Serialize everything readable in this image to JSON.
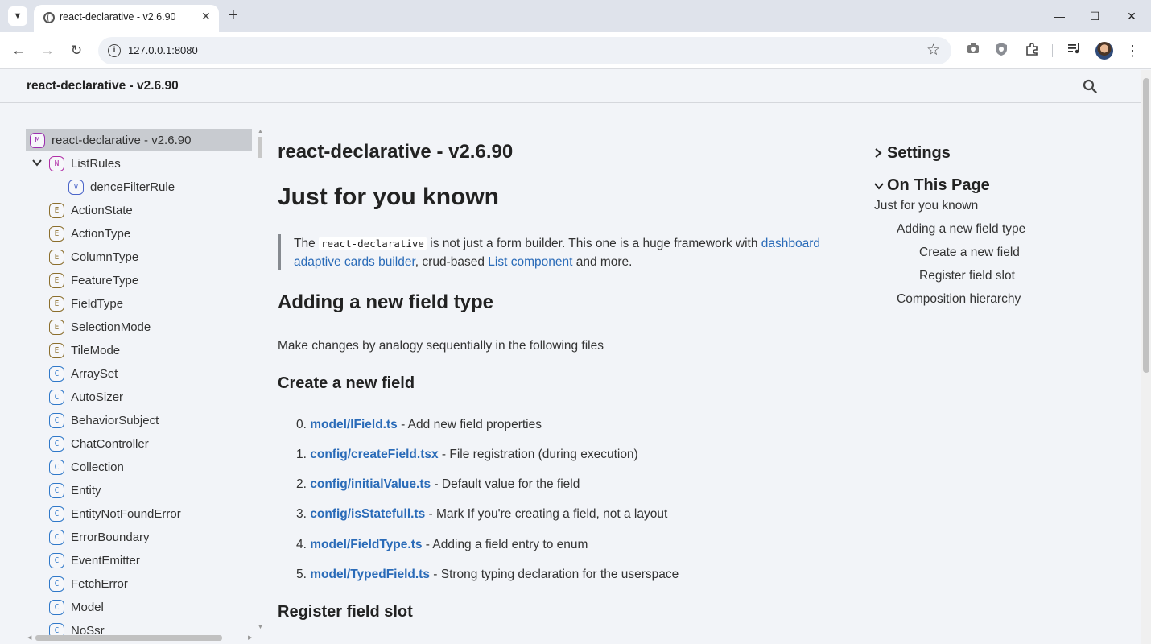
{
  "browser": {
    "tab_title": "react-declarative - v2.6.90",
    "url": "127.0.0.1:8080"
  },
  "header": {
    "site_title": "react-declarative - v2.6.90"
  },
  "sidebar": {
    "root": {
      "kind": "M",
      "label": "react-declarative - v2.6.90"
    },
    "group": {
      "kind": "N",
      "label": "ListRules"
    },
    "child": {
      "kind": "V",
      "label": "denceFilterRule"
    },
    "items": [
      {
        "kind": "E",
        "label": "ActionState"
      },
      {
        "kind": "E",
        "label": "ActionType"
      },
      {
        "kind": "E",
        "label": "ColumnType"
      },
      {
        "kind": "E",
        "label": "FeatureType"
      },
      {
        "kind": "E",
        "label": "FieldType"
      },
      {
        "kind": "E",
        "label": "SelectionMode"
      },
      {
        "kind": "E",
        "label": "TileMode"
      },
      {
        "kind": "C",
        "label": "ArraySet"
      },
      {
        "kind": "C",
        "label": "AutoSizer"
      },
      {
        "kind": "C",
        "label": "BehaviorSubject"
      },
      {
        "kind": "C",
        "label": "ChatController"
      },
      {
        "kind": "C",
        "label": "Collection"
      },
      {
        "kind": "C",
        "label": "Entity"
      },
      {
        "kind": "C",
        "label": "EntityNotFoundError"
      },
      {
        "kind": "C",
        "label": "ErrorBoundary"
      },
      {
        "kind": "C",
        "label": "EventEmitter"
      },
      {
        "kind": "C",
        "label": "FetchError"
      },
      {
        "kind": "C",
        "label": "Model"
      },
      {
        "kind": "C",
        "label": "NoSsr"
      }
    ]
  },
  "main": {
    "title": "react-declarative - v2.6.90",
    "h1": "Just for you known",
    "quote": {
      "t1": "The ",
      "code": "react-declarative",
      "t2": " is not just a form builder. This one is a huge framework with ",
      "link1": "dashboard adaptive cards builder",
      "t3": ", crud-based ",
      "link2": "List component",
      "t4": " and more."
    },
    "h2": "Adding a new field type",
    "para": "Make changes by analogy sequentially in the following files",
    "h3_create": "Create a new field",
    "steps": [
      {
        "num": "0.",
        "file": "model/IField.ts",
        "desc": " - Add new field properties"
      },
      {
        "num": "1.",
        "file": "config/createField.tsx",
        "desc": " - File registration (during execution)"
      },
      {
        "num": "2.",
        "file": "config/initialValue.ts",
        "desc": " - Default value for the field"
      },
      {
        "num": "3.",
        "file": "config/isStatefull.ts",
        "desc": " - Mark If you're creating a field, not a layout"
      },
      {
        "num": "4.",
        "file": "model/FieldType.ts",
        "desc": " - Adding a field entry to enum"
      },
      {
        "num": "5.",
        "file": "model/TypedField.ts",
        "desc": " - Strong typing declaration for the userspace"
      }
    ],
    "h3_register": "Register field slot"
  },
  "right": {
    "settings": "Settings",
    "on_this_page": "On This Page",
    "toc": [
      "Just for you known",
      "Adding a new field type",
      "Create a new field",
      "Register field slot",
      "Composition hierarchy"
    ]
  }
}
